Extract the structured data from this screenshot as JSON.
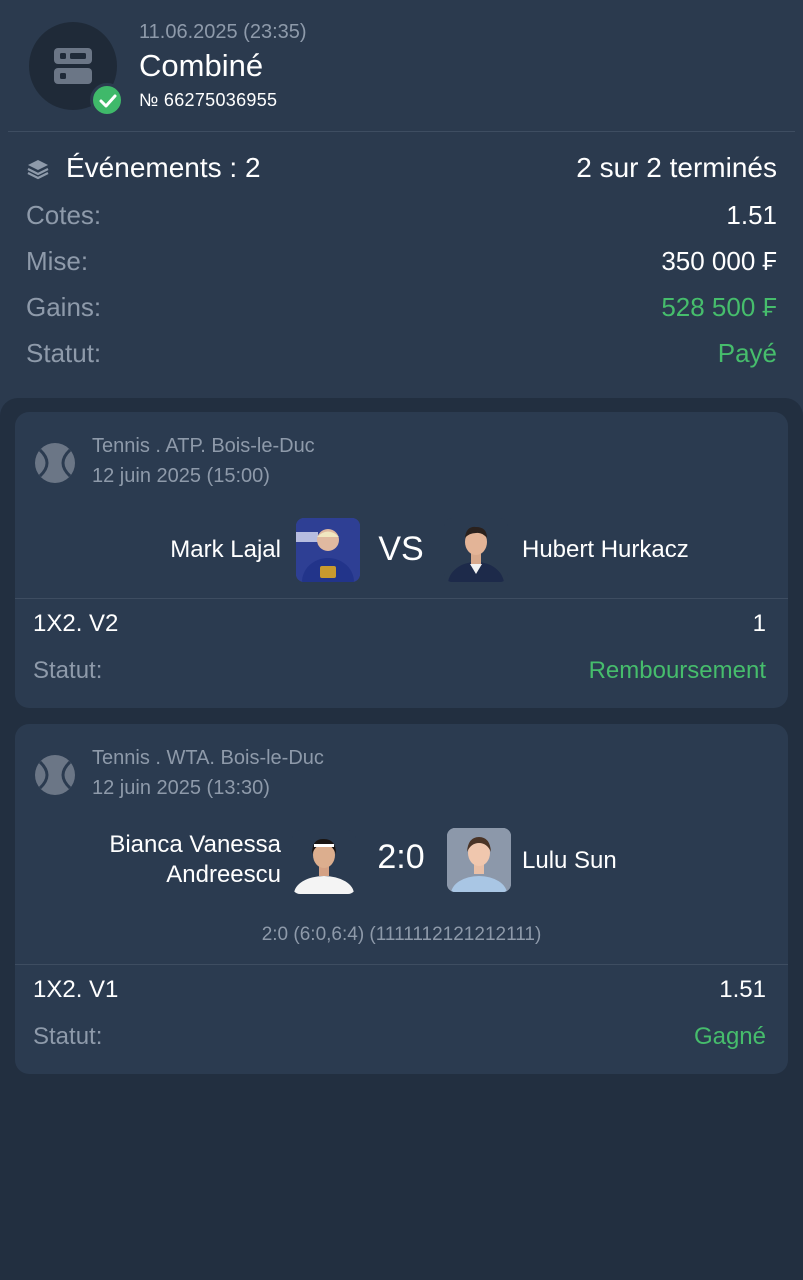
{
  "header": {
    "date": "11.06.2025 (23:35)",
    "title": "Combiné",
    "number": "№ 66275036955",
    "icon": "ticket-icon",
    "badge_icon": "check-icon"
  },
  "summary": {
    "events_label": "Événements : 2",
    "events_status": "2 sur 2 terminés",
    "odds_label": "Cotes:",
    "odds_value": "1.51",
    "stake_label": "Mise:",
    "stake_value": "350 000 ₣",
    "winnings_label": "Gains:",
    "winnings_value": "528 500 ₣",
    "status_label": "Statut:",
    "status_value": "Payé"
  },
  "events": [
    {
      "sport_icon": "tennis-ball-icon",
      "league": "Tennis . ATP. Bois-le-Duc",
      "date": "12 juin 2025 (15:00)",
      "team1": "Mark Lajal",
      "team2": "Hubert Hurkacz",
      "center": "VS",
      "market": "1X2. V2",
      "odd": "1",
      "status_label": "Statut:",
      "status_value": "Remboursement"
    },
    {
      "sport_icon": "tennis-ball-icon",
      "league": "Tennis . WTA. Bois-le-Duc",
      "date": "12 juin 2025 (13:30)",
      "team1_line1": "Bianca Vanessa",
      "team1_line2": "Andreescu",
      "team2": "Lulu Sun",
      "center": "2:0",
      "score_detail": "2:0 (6:0,6:4) (1111112121212111)",
      "market": "1X2. V1",
      "odd": "1.51",
      "status_label": "Statut:",
      "status_value": "Gagné"
    }
  ],
  "colors": {
    "background": "#2b3a4e",
    "card": "#2b3b50",
    "list_bg": "#222f40",
    "green": "#46bd6c",
    "muted": "#8e9aaa"
  }
}
